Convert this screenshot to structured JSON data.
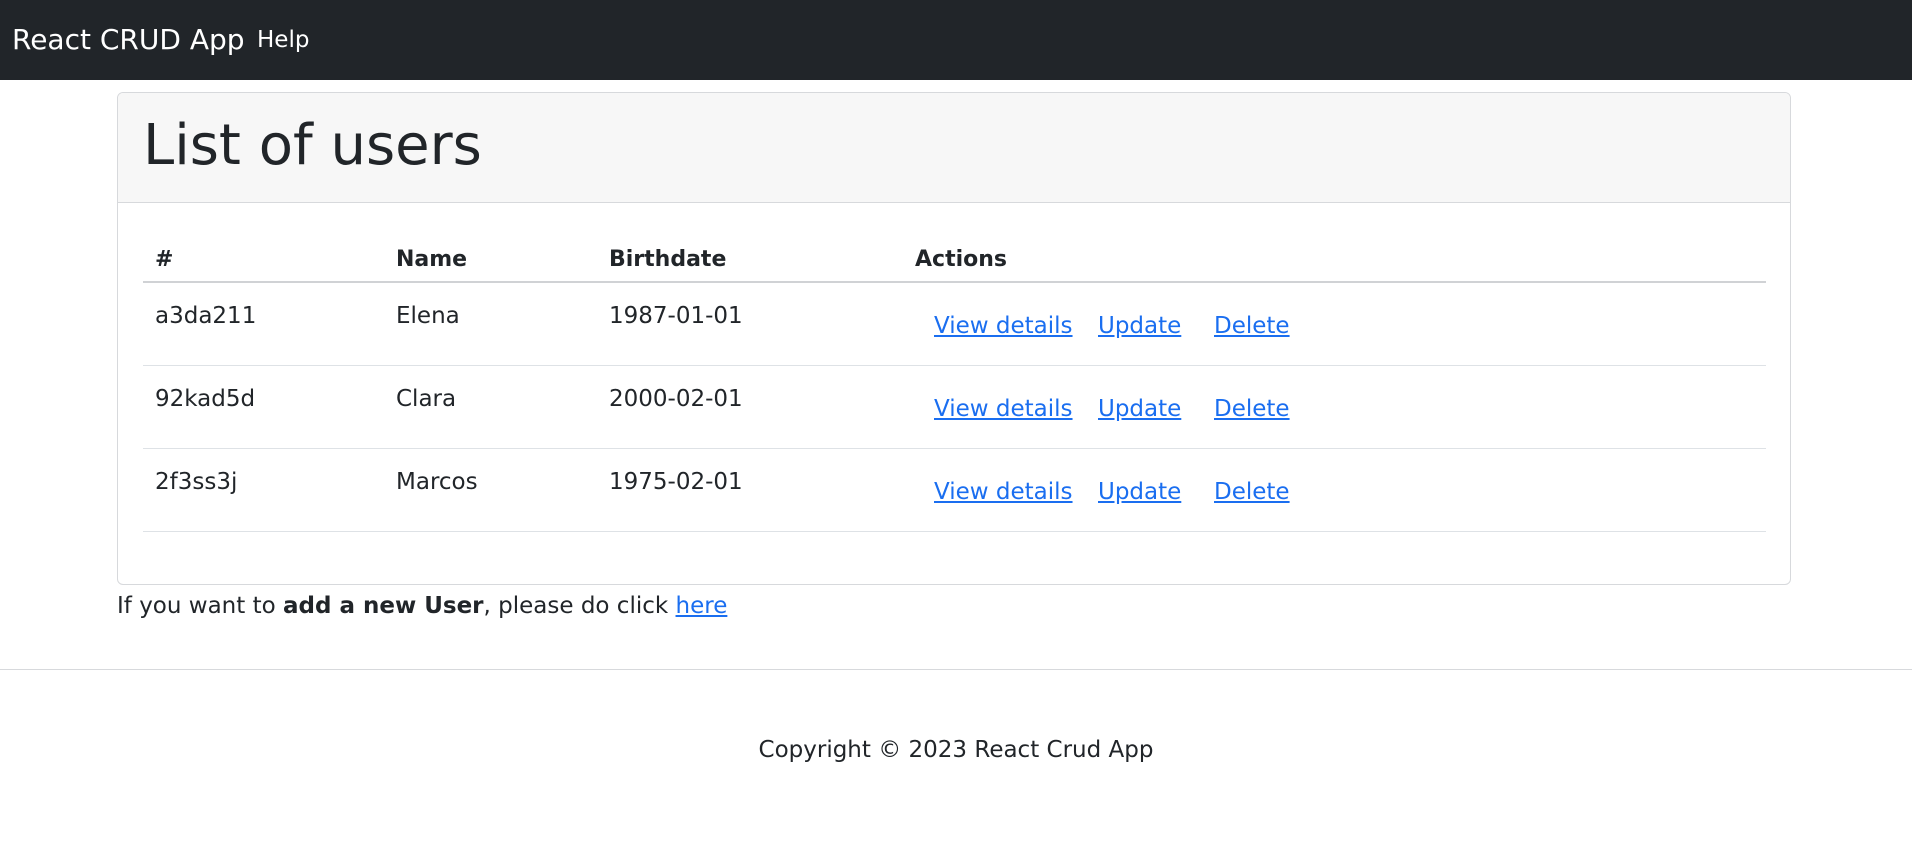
{
  "navbar": {
    "brand": "React CRUD App",
    "help_label": "Help"
  },
  "card": {
    "title": "List of users"
  },
  "table": {
    "headers": [
      "#",
      "Name",
      "Birthdate",
      "Actions"
    ],
    "rows": [
      {
        "id": "a3da211",
        "name": "Elena",
        "birthdate": "1987-01-01"
      },
      {
        "id": "92kad5d",
        "name": "Clara",
        "birthdate": "2000-02-01"
      },
      {
        "id": "2f3ss3j",
        "name": "Marcos",
        "birthdate": "1975-02-01"
      }
    ],
    "actions": {
      "view": "View details",
      "update": "Update",
      "delete": "Delete"
    }
  },
  "add_user": {
    "prefix": "If you want to ",
    "bold": "add a new User",
    "middle": ", please do click ",
    "link": "here"
  },
  "footer": {
    "text": "Copyright © 2023 React Crud App"
  },
  "colors": {
    "navbar_bg": "#212529",
    "link": "#1a6ef0",
    "card_header_bg": "#f7f7f7"
  }
}
